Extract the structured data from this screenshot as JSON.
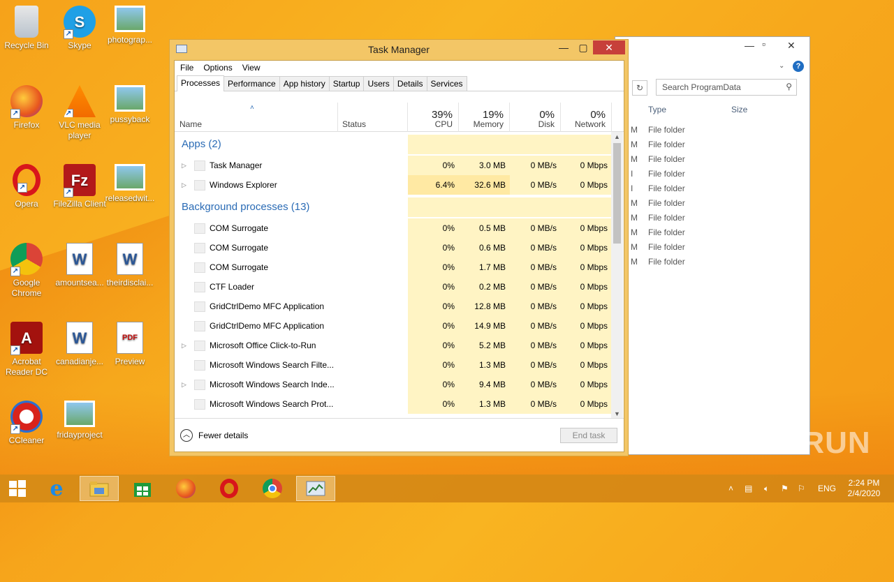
{
  "desktop": {
    "icons": [
      {
        "label": "Recycle Bin",
        "icon": "recycle-bin-icon"
      },
      {
        "label": "Skype",
        "icon": "skype-icon"
      },
      {
        "label": "photograp...",
        "icon": "image-file-icon"
      },
      {
        "label": "Firefox",
        "icon": "firefox-icon"
      },
      {
        "label": "VLC media player",
        "icon": "vlc-icon"
      },
      {
        "label": "pussyback",
        "icon": "image-file-icon"
      },
      {
        "label": "Opera",
        "icon": "opera-icon"
      },
      {
        "label": "FileZilla Client",
        "icon": "filezilla-icon"
      },
      {
        "label": "releasedwit...",
        "icon": "image-file-icon"
      },
      {
        "label": "Google Chrome",
        "icon": "chrome-icon"
      },
      {
        "label": "amountsea...",
        "icon": "word-doc-icon"
      },
      {
        "label": "theirdisclai...",
        "icon": "word-doc-icon"
      },
      {
        "label": "Acrobat Reader DC",
        "icon": "acrobat-icon"
      },
      {
        "label": "canadianje...",
        "icon": "word-doc-icon"
      },
      {
        "label": "Preview",
        "icon": "pdf-file-icon"
      },
      {
        "label": "CCleaner",
        "icon": "ccleaner-icon"
      },
      {
        "label": "fridayproject",
        "icon": "image-file-icon"
      }
    ]
  },
  "explorer": {
    "search_placeholder": "Search ProgramData",
    "col_type": "Type",
    "col_size": "Size",
    "rows": [
      "File folder",
      "File folder",
      "File folder",
      "File folder",
      "File folder",
      "File folder",
      "File folder",
      "File folder",
      "File folder",
      "File folder"
    ],
    "partial": [
      "M",
      "M",
      "M",
      "I",
      "I",
      "M",
      "M",
      "M",
      "M",
      "M"
    ]
  },
  "taskmgr": {
    "title": "Task Manager",
    "menu": [
      "File",
      "Options",
      "View"
    ],
    "tabs": [
      "Processes",
      "Performance",
      "App history",
      "Startup",
      "Users",
      "Details",
      "Services"
    ],
    "active_tab": "Processes",
    "columns": {
      "name": "Name",
      "status": "Status",
      "cpu": {
        "pct": "39%",
        "label": "CPU"
      },
      "memory": {
        "pct": "19%",
        "label": "Memory"
      },
      "disk": {
        "pct": "0%",
        "label": "Disk"
      },
      "network": {
        "pct": "0%",
        "label": "Network"
      }
    },
    "groups": {
      "apps": "Apps (2)",
      "background": "Background processes (13)"
    },
    "apps": [
      {
        "name": "Task Manager",
        "cpu": "0%",
        "mem": "3.0 MB",
        "disk": "0 MB/s",
        "net": "0 Mbps",
        "expand": true
      },
      {
        "name": "Windows Explorer",
        "cpu": "6.4%",
        "mem": "32.6 MB",
        "disk": "0 MB/s",
        "net": "0 Mbps",
        "expand": true
      }
    ],
    "background": [
      {
        "name": "COM Surrogate",
        "cpu": "0%",
        "mem": "0.5 MB",
        "disk": "0 MB/s",
        "net": "0 Mbps",
        "expand": false
      },
      {
        "name": "COM Surrogate",
        "cpu": "0%",
        "mem": "0.6 MB",
        "disk": "0 MB/s",
        "net": "0 Mbps",
        "expand": false
      },
      {
        "name": "COM Surrogate",
        "cpu": "0%",
        "mem": "1.7 MB",
        "disk": "0 MB/s",
        "net": "0 Mbps",
        "expand": false
      },
      {
        "name": "CTF Loader",
        "cpu": "0%",
        "mem": "0.2 MB",
        "disk": "0 MB/s",
        "net": "0 Mbps",
        "expand": false
      },
      {
        "name": "GridCtrlDemo MFC Application",
        "cpu": "0%",
        "mem": "12.8 MB",
        "disk": "0 MB/s",
        "net": "0 Mbps",
        "expand": false
      },
      {
        "name": "GridCtrlDemo MFC Application",
        "cpu": "0%",
        "mem": "14.9 MB",
        "disk": "0 MB/s",
        "net": "0 Mbps",
        "expand": false
      },
      {
        "name": "Microsoft Office Click-to-Run",
        "cpu": "0%",
        "mem": "5.2 MB",
        "disk": "0 MB/s",
        "net": "0 Mbps",
        "expand": true
      },
      {
        "name": "Microsoft Windows Search Filte...",
        "cpu": "0%",
        "mem": "1.3 MB",
        "disk": "0 MB/s",
        "net": "0 Mbps",
        "expand": false
      },
      {
        "name": "Microsoft Windows Search Inde...",
        "cpu": "0%",
        "mem": "9.4 MB",
        "disk": "0 MB/s",
        "net": "0 Mbps",
        "expand": true
      },
      {
        "name": "Microsoft Windows Search Prot...",
        "cpu": "0%",
        "mem": "1.3 MB",
        "disk": "0 MB/s",
        "net": "0 Mbps",
        "expand": false
      }
    ],
    "fewer_details": "Fewer details",
    "end_task": "End task"
  },
  "taskbar": {
    "apps": [
      "start-icon",
      "internet-explorer-icon",
      "file-explorer-icon",
      "store-icon",
      "firefox-icon",
      "opera-icon",
      "chrome-icon",
      "task-manager-icon"
    ],
    "language": "ENG",
    "time": "2:24 PM",
    "date": "2/4/2020"
  },
  "watermark": "ANY RUN",
  "colors": {
    "accent_yellow": "#f9b421",
    "heat_cell": "#fff4c4",
    "heat_cell_strong": "#ffe9a3",
    "group_blue": "#2a6bb5",
    "close_red": "#c7403a"
  }
}
